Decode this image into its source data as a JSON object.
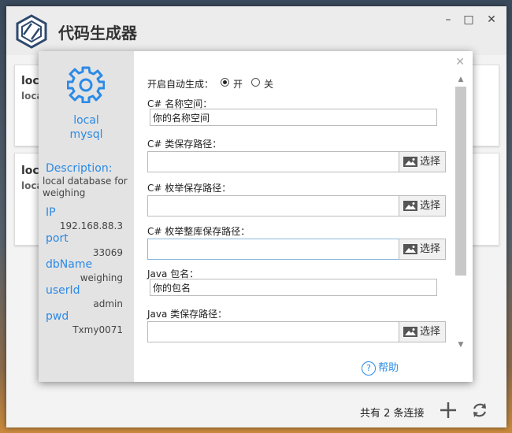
{
  "app": {
    "title": "代码生成器",
    "window_controls": {
      "minimize": "–",
      "maximize": "□",
      "close": "✕"
    }
  },
  "background_cards": [
    {
      "title": "local",
      "subtitle": "local"
    },
    {
      "title": "local",
      "subtitle": "local"
    }
  ],
  "footer": {
    "count_text": "共有 2 条连接",
    "add_icon": "plus-icon",
    "refresh_icon": "refresh-icon"
  },
  "dialog": {
    "close": "✕",
    "connection": {
      "name": "local",
      "type": "mysql",
      "description_label": "Description:",
      "description": "local database for weighing",
      "fields": [
        {
          "key": "IP",
          "value": "192.168.88.3"
        },
        {
          "key": "port",
          "value": "33069"
        },
        {
          "key": "dbName",
          "value": "weighing"
        },
        {
          "key": "userId",
          "value": "admin"
        },
        {
          "key": "pwd",
          "value": "Txmy0071"
        }
      ]
    },
    "form": {
      "auto_gen_label": "开启自动生成：",
      "auto_gen_on": "开",
      "auto_gen_off": "关",
      "auto_gen_value": "开",
      "cs_namespace_label": "C# 名称空间：",
      "cs_namespace_value": "你的名称空间",
      "cs_class_path_label": "C# 类保存路径：",
      "cs_class_path_value": "",
      "cs_enum_path_label": "C# 枚举保存路径：",
      "cs_enum_path_value": "",
      "cs_enum_lib_path_label": "C# 枚举整库保存路径：",
      "cs_enum_lib_path_value": "",
      "java_package_label": "Java 包名：",
      "java_package_value": "你的包名",
      "java_class_path_label": "Java 类保存路径：",
      "java_class_path_value": "",
      "choose_label": "选择",
      "help_label": "帮助"
    },
    "accent_color": "#2b8ae6"
  }
}
